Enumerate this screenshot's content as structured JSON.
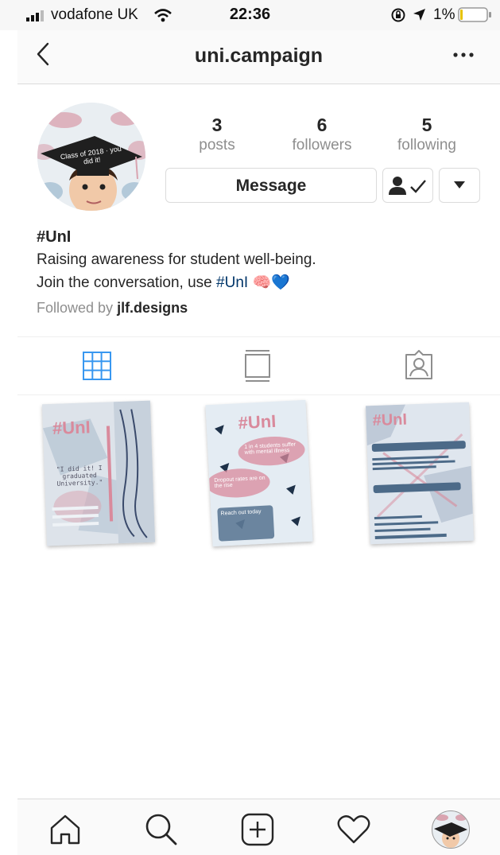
{
  "status_bar": {
    "carrier": "vodafone UK",
    "time": "22:36",
    "battery": "1%"
  },
  "nav": {
    "title": "uni.campaign"
  },
  "profile": {
    "avatar_caption": "Class of 2018 · you did it!",
    "stats": [
      {
        "value": "3",
        "label": "posts"
      },
      {
        "value": "6",
        "label": "followers"
      },
      {
        "value": "5",
        "label": "following"
      }
    ],
    "message_button": "Message",
    "name": "#UnI",
    "bio_line1": "Raising awareness for student well-being.",
    "bio_line2_prefix": "Join the conversation, use ",
    "bio_hashtag": "#UnI",
    "bio_emoji": "🧠💙",
    "followed_by_prefix": "Followed by ",
    "followed_by_name": "jlf.designs"
  },
  "tabs": [
    "grid-view",
    "feed-view",
    "tagged"
  ],
  "posts": [
    {
      "title": "#UnI",
      "quote": "\"I did it! I graduated University.\""
    },
    {
      "title": "#UnI",
      "line1": "1 in 4 students suffer with mental illness",
      "line2": "Dropout rates are on the rise",
      "line3": "Reach out today"
    },
    {
      "title": "#UnI"
    }
  ],
  "colors": {
    "accent": "#3897f0",
    "hashtag": "#003569",
    "muted": "#8e8e8e",
    "poster_pink": "#d98a9c",
    "poster_blue": "#b7c6d6"
  }
}
